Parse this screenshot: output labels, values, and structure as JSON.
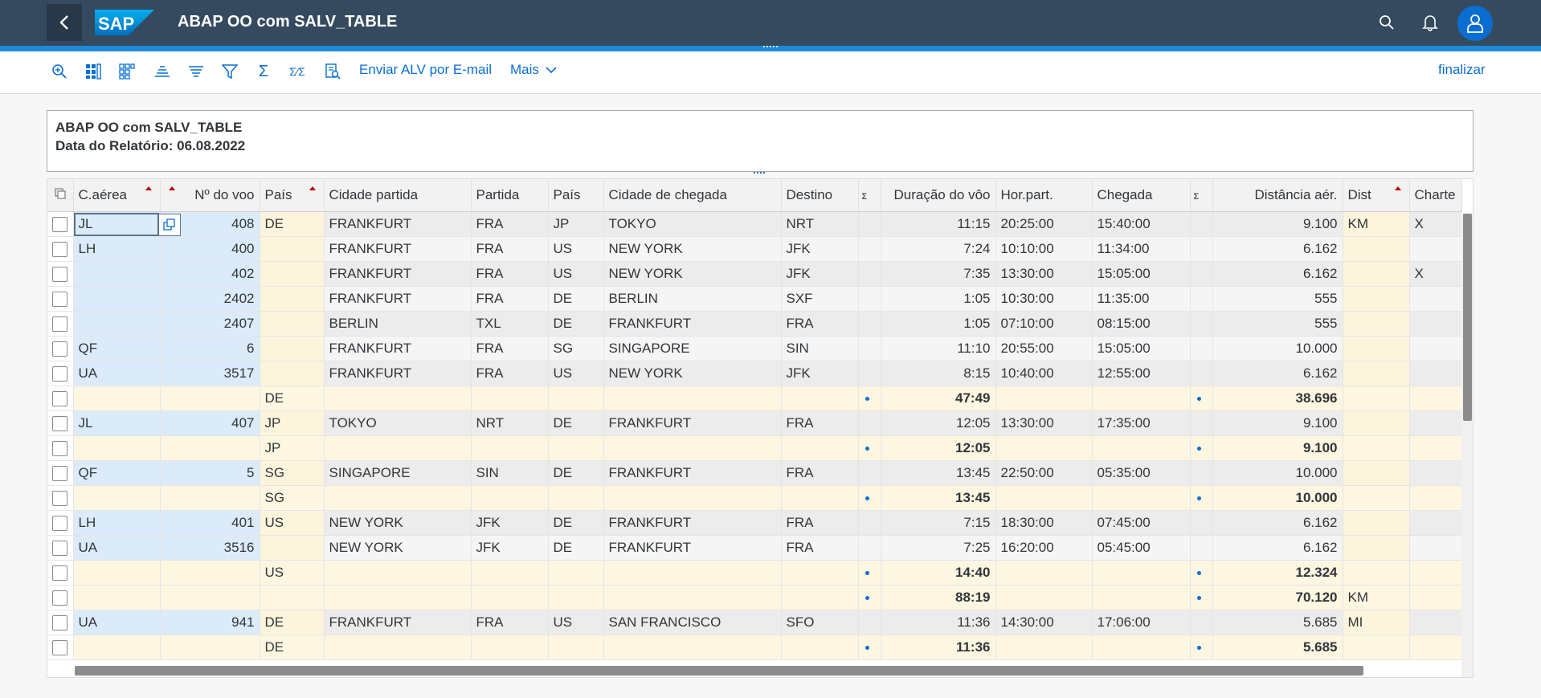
{
  "shell": {
    "title": "ABAP OO com SALV_TABLE",
    "logo_text": "SAP",
    "colors": {
      "shell_bg": "#354a5f",
      "accent": "#0a6ed1",
      "progress": "#1f8ad9"
    }
  },
  "toolbar": {
    "icons": [
      "zoom-icon",
      "layout-icon",
      "select-layout-icon",
      "sort-asc-icon",
      "sort-desc-icon",
      "filter-icon",
      "sum-icon",
      "subtotal-icon",
      "print-preview-icon"
    ],
    "email_label": "Enviar ALV por E-mail",
    "more_label": "Mais",
    "finish_label": "finalizar"
  },
  "header_info": {
    "line1": "ABAP OO com SALV_TABLE",
    "line2": "Data do Relatório: 06.08.2022"
  },
  "grid": {
    "columns": {
      "carrid": "C.aérea",
      "connid": "Nº do voo",
      "countryfr": "País",
      "cityfrom": "Cidade partida",
      "airpfrom": "Partida",
      "countryto": "País",
      "cityto": "Cidade de chegada",
      "airpto": "Destino",
      "sum1": "Σ",
      "fltime": "Duração do vôo",
      "deptime": "Hor.part.",
      "arrtime": "Chegada",
      "sum2": "Σ",
      "distance": "Distância aér.",
      "distid": "Dist",
      "fltype": "Charte"
    },
    "rows": [
      {
        "kind": "data",
        "carrid": "JL",
        "connid": "408",
        "countryfr": "DE",
        "cityfrom": "FRANKFURT",
        "airpfrom": "FRA",
        "countryto": "JP",
        "cityto": "TOKYO",
        "airpto": "NRT",
        "fltime": "11:15",
        "deptime": "20:25:00",
        "arrtime": "15:40:00",
        "distance": "9.100",
        "distid": "KM",
        "fltype": "X"
      },
      {
        "kind": "data",
        "carrid": "LH",
        "connid": "400",
        "countryfr": "",
        "cityfrom": "FRANKFURT",
        "airpfrom": "FRA",
        "countryto": "US",
        "cityto": "NEW YORK",
        "airpto": "JFK",
        "fltime": "7:24",
        "deptime": "10:10:00",
        "arrtime": "11:34:00",
        "distance": "6.162",
        "distid": "",
        "fltype": ""
      },
      {
        "kind": "data",
        "carrid": "",
        "connid": "402",
        "countryfr": "",
        "cityfrom": "FRANKFURT",
        "airpfrom": "FRA",
        "countryto": "US",
        "cityto": "NEW YORK",
        "airpto": "JFK",
        "fltime": "7:35",
        "deptime": "13:30:00",
        "arrtime": "15:05:00",
        "distance": "6.162",
        "distid": "",
        "fltype": "X"
      },
      {
        "kind": "data",
        "carrid": "",
        "connid": "2402",
        "countryfr": "",
        "cityfrom": "FRANKFURT",
        "airpfrom": "FRA",
        "countryto": "DE",
        "cityto": "BERLIN",
        "airpto": "SXF",
        "fltime": "1:05",
        "deptime": "10:30:00",
        "arrtime": "11:35:00",
        "distance": "555",
        "distid": "",
        "fltype": ""
      },
      {
        "kind": "data",
        "carrid": "",
        "connid": "2407",
        "countryfr": "",
        "cityfrom": "BERLIN",
        "airpfrom": "TXL",
        "countryto": "DE",
        "cityto": "FRANKFURT",
        "airpto": "FRA",
        "fltime": "1:05",
        "deptime": "07:10:00",
        "arrtime": "08:15:00",
        "distance": "555",
        "distid": "",
        "fltype": ""
      },
      {
        "kind": "data",
        "carrid": "QF",
        "connid": "6",
        "countryfr": "",
        "cityfrom": "FRANKFURT",
        "airpfrom": "FRA",
        "countryto": "SG",
        "cityto": "SINGAPORE",
        "airpto": "SIN",
        "fltime": "11:10",
        "deptime": "20:55:00",
        "arrtime": "15:05:00",
        "distance": "10.000",
        "distid": "",
        "fltype": ""
      },
      {
        "kind": "data",
        "carrid": "UA",
        "connid": "3517",
        "countryfr": "",
        "cityfrom": "FRANKFURT",
        "airpfrom": "FRA",
        "countryto": "US",
        "cityto": "NEW YORK",
        "airpto": "JFK",
        "fltime": "8:15",
        "deptime": "10:40:00",
        "arrtime": "12:55:00",
        "distance": "6.162",
        "distid": "",
        "fltype": ""
      },
      {
        "kind": "sub",
        "level": 1,
        "countryfr": "DE",
        "fltime": "47:49",
        "distance": "38.696",
        "distid": ""
      },
      {
        "kind": "data",
        "carrid": "JL",
        "connid": "407",
        "countryfr": "JP",
        "cityfrom": "TOKYO",
        "airpfrom": "NRT",
        "countryto": "DE",
        "cityto": "FRANKFURT",
        "airpto": "FRA",
        "fltime": "12:05",
        "deptime": "13:30:00",
        "arrtime": "17:35:00",
        "distance": "9.100",
        "distid": "",
        "fltype": ""
      },
      {
        "kind": "sub",
        "level": 1,
        "countryfr": "JP",
        "fltime": "12:05",
        "distance": "9.100",
        "distid": ""
      },
      {
        "kind": "data",
        "carrid": "QF",
        "connid": "5",
        "countryfr": "SG",
        "cityfrom": "SINGAPORE",
        "airpfrom": "SIN",
        "countryto": "DE",
        "cityto": "FRANKFURT",
        "airpto": "FRA",
        "fltime": "13:45",
        "deptime": "22:50:00",
        "arrtime": "05:35:00",
        "distance": "10.000",
        "distid": "",
        "fltype": ""
      },
      {
        "kind": "sub",
        "level": 1,
        "countryfr": "SG",
        "fltime": "13:45",
        "distance": "10.000",
        "distid": ""
      },
      {
        "kind": "data",
        "carrid": "LH",
        "connid": "401",
        "countryfr": "US",
        "cityfrom": "NEW YORK",
        "airpfrom": "JFK",
        "countryto": "DE",
        "cityto": "FRANKFURT",
        "airpto": "FRA",
        "fltime": "7:15",
        "deptime": "18:30:00",
        "arrtime": "07:45:00",
        "distance": "6.162",
        "distid": "",
        "fltype": ""
      },
      {
        "kind": "data",
        "carrid": "UA",
        "connid": "3516",
        "countryfr": "",
        "cityfrom": "NEW YORK",
        "airpfrom": "JFK",
        "countryto": "DE",
        "cityto": "FRANKFURT",
        "airpto": "FRA",
        "fltime": "7:25",
        "deptime": "16:20:00",
        "arrtime": "05:45:00",
        "distance": "6.162",
        "distid": "",
        "fltype": ""
      },
      {
        "kind": "sub",
        "level": 1,
        "countryfr": "US",
        "fltime": "14:40",
        "distance": "12.324",
        "distid": ""
      },
      {
        "kind": "sub",
        "level": 2,
        "countryfr": "",
        "fltime": "88:19",
        "distance": "70.120",
        "distid": "KM"
      },
      {
        "kind": "data",
        "carrid": "UA",
        "connid": "941",
        "countryfr": "DE",
        "cityfrom": "FRANKFURT",
        "airpfrom": "FRA",
        "countryto": "US",
        "cityto": "SAN FRANCISCO",
        "airpto": "SFO",
        "fltime": "11:36",
        "deptime": "14:30:00",
        "arrtime": "17:06:00",
        "distance": "5.685",
        "distid": "MI",
        "fltype": ""
      },
      {
        "kind": "sub",
        "level": 1,
        "countryfr": "DE",
        "fltime": "11:36",
        "distance": "5.685",
        "distid": ""
      }
    ]
  }
}
